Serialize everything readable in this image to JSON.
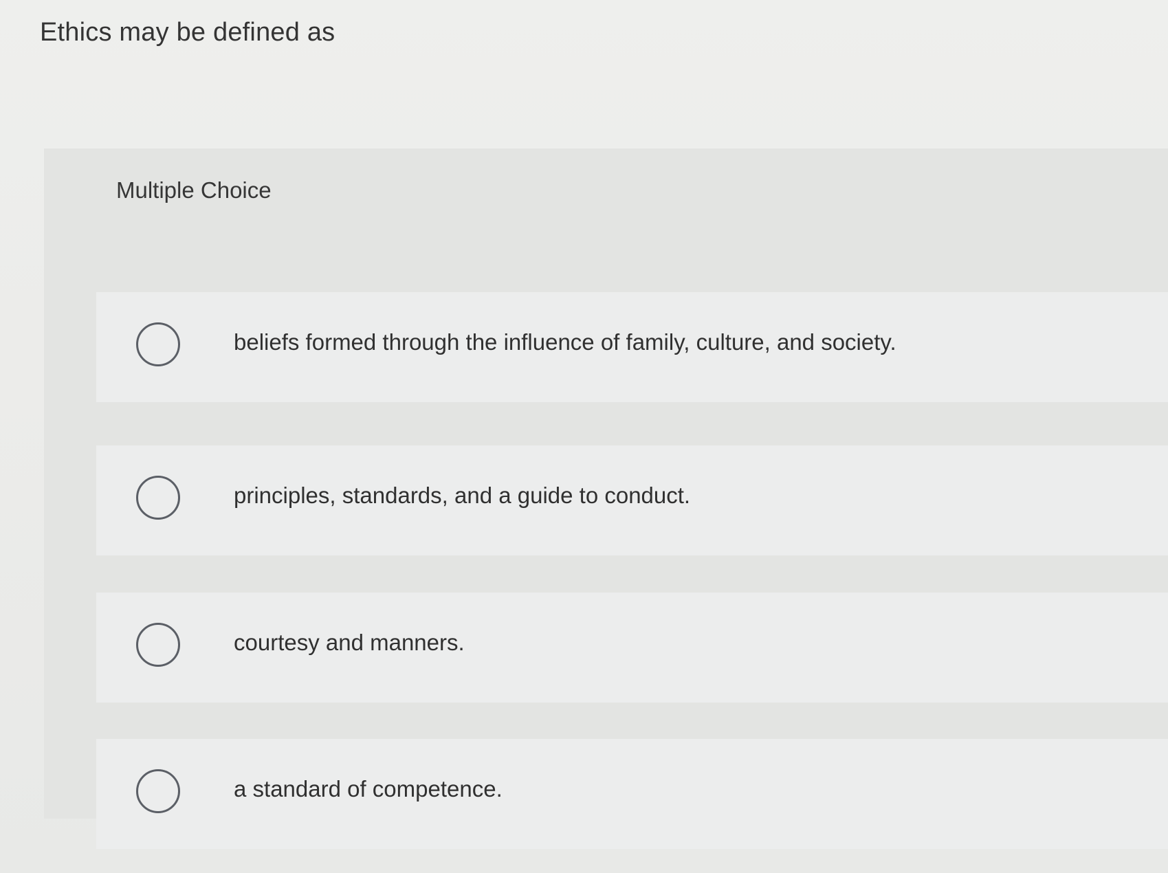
{
  "question": {
    "text": "Ethics may be defined as"
  },
  "panel": {
    "title": "Multiple Choice"
  },
  "options": [
    {
      "label": "beliefs formed through the influence of family, culture, and society.",
      "selected": false
    },
    {
      "label": "principles, standards, and a guide to conduct.",
      "selected": false
    },
    {
      "label": "courtesy and manners.",
      "selected": false
    },
    {
      "label": "a standard of competence.",
      "selected": false
    }
  ]
}
